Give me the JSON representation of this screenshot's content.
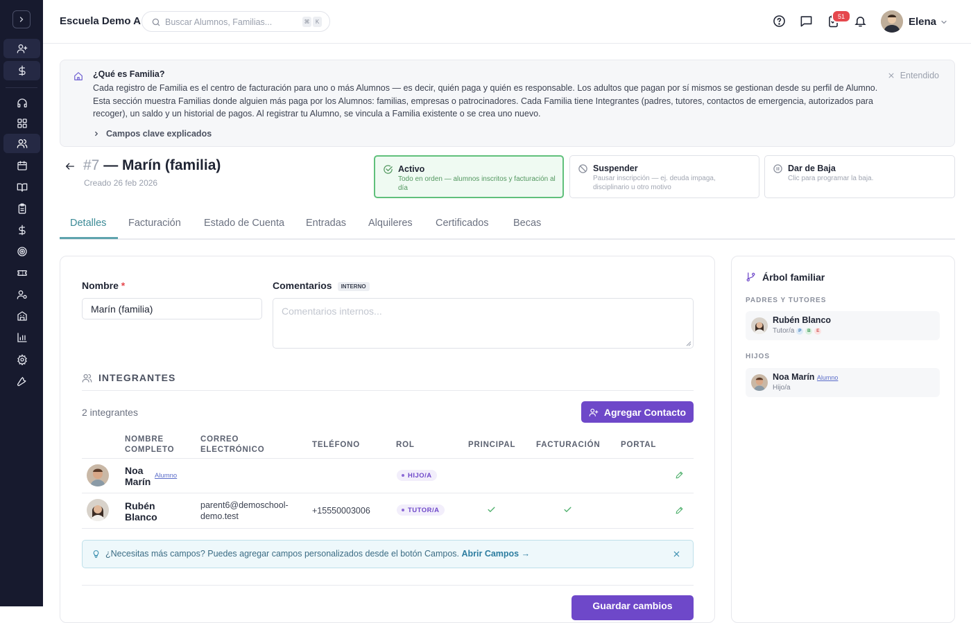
{
  "topbar": {
    "school": "Escuela Demo A",
    "search_placeholder": "Buscar Alumnos, Familias...",
    "kbd1": "⌘",
    "kbd2": "K",
    "notifications_count": "51",
    "user_name": "Elena"
  },
  "info": {
    "title": "¿Qué es Familia?",
    "body": "Cada registro de Familia es el centro de facturación para uno o más Alumnos — es decir, quién paga y quién es responsable. Los adultos que pagan por sí mismos se gestionan desde su perfil de Alumno. Esta sección muestra Familias donde alguien más paga por los Alumnos: familias, empresas o patrocinadores. Cada Familia tiene Integrantes (padres, tutores, contactos de emergencia, autorizados para recoger), un saldo y un historial de pagos. Al registrar tu Alumno, se vincula a Familia existente o se crea uno nuevo.",
    "toggle": "Campos clave explicados",
    "dismiss": "Entendido"
  },
  "header": {
    "number": "#7",
    "title": "— Marín (familia)",
    "created": "Creado 26 feb 2026"
  },
  "statuses": [
    {
      "label": "Activo",
      "desc": "Todo en orden — alumnos inscritos y facturación al día",
      "selected": true
    },
    {
      "label": "Suspender",
      "desc": "Pausar inscripción — ej. deuda impaga, disciplinario u otro motivo"
    },
    {
      "label": "Dar de Baja",
      "desc": "Clic para programar la baja."
    }
  ],
  "tabs": [
    "Detalles",
    "Facturación",
    "Estado de Cuenta",
    "Entradas",
    "Alquileres",
    "Certificados",
    "Becas"
  ],
  "form": {
    "name_label": "Nombre",
    "required_mark": "*",
    "name_value": "Marín (familia)",
    "comments_label": "Comentarios",
    "internal_chip": "INTERNO",
    "comments_placeholder": "Comentarios internos..."
  },
  "members": {
    "section_title": "INTEGRANTES",
    "count": "2 integrantes",
    "add_button": "Agregar Contacto",
    "columns": {
      "name1": "NOMBRE",
      "name2": "COMPLETO",
      "email1": "CORREO",
      "email2": "ELECTRÓNICO",
      "phone": "TELÉFONO",
      "role": "ROL",
      "primary": "PRINCIPAL",
      "billing": "FACTURACIÓN",
      "portal": "PORTAL"
    },
    "rows": [
      {
        "first": "Noa",
        "last": "Marín",
        "link": "Alumno",
        "email1": "",
        "email2": "",
        "phone": "",
        "role": "HIJO/A",
        "primary": false,
        "billing": false
      },
      {
        "first": "Rubén",
        "last": "Blanco",
        "link": "",
        "email1": "parent6@demoschool-",
        "email2": "demo.test",
        "phone": "+15550003006",
        "role": "TUTOR/A",
        "primary": true,
        "billing": true
      }
    ],
    "tip_text": "¿Necesitas más campos? Puedes agregar campos personalizados desde el botón Campos.",
    "tip_link": "Abrir Campos →",
    "save_button": "Guardar cambios"
  },
  "tree": {
    "title": "Árbol familiar",
    "parents_label": "PADRES Y TUTORES",
    "children_label": "HIJOS",
    "parent": {
      "name": "Rubén Blanco",
      "role": "Tutor/a",
      "chips": [
        "P",
        "B",
        "E"
      ]
    },
    "child": {
      "name": "Noa Marín",
      "link": "Alumno",
      "role": "Hijo/a"
    }
  },
  "colors": {
    "sidebar": "#171a2e",
    "accent": "#6e48c9",
    "tab_active": "#3b8a96",
    "active_status": "#5fc07b"
  }
}
